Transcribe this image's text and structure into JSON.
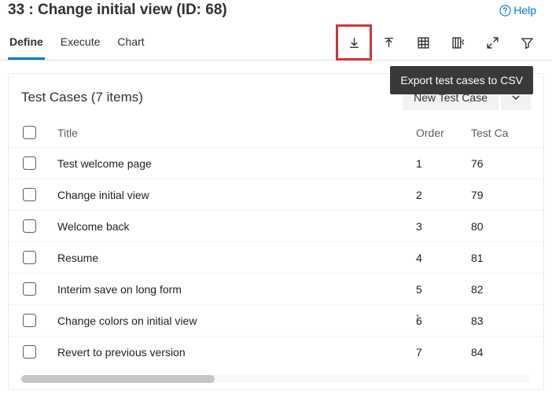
{
  "header": {
    "title": "33 : Change initial view (ID: 68)",
    "help": "Help"
  },
  "tabs": [
    "Define",
    "Execute",
    "Chart"
  ],
  "tooltip": "Export test cases to CSV",
  "panel": {
    "title": "Test Cases (7 items)",
    "new_btn": "New Test Case"
  },
  "columns": {
    "title": "Title",
    "order": "Order",
    "tc": "Test Ca"
  },
  "rows": [
    {
      "title": "Test welcome page",
      "order": "1",
      "tc": "76"
    },
    {
      "title": "Change initial view",
      "order": "2",
      "tc": "79"
    },
    {
      "title": "Welcome back",
      "order": "3",
      "tc": "80"
    },
    {
      "title": "Resume",
      "order": "4",
      "tc": "81"
    },
    {
      "title": "Interim save on long form",
      "order": "5",
      "tc": "82"
    },
    {
      "title": "Change colors on initial view",
      "order": "6",
      "tc": "83"
    },
    {
      "title": "Revert to previous version",
      "order": "7",
      "tc": "84"
    }
  ]
}
